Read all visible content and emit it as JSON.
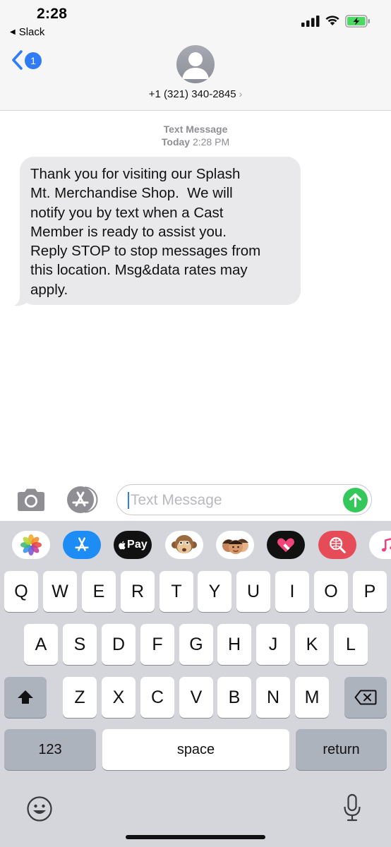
{
  "status_bar": {
    "time": "2:28",
    "back_app": "Slack",
    "icons": [
      "signal-icon",
      "wifi-icon",
      "battery-charging-icon"
    ],
    "battery_color": "#4cd964"
  },
  "header": {
    "back_badge": "1",
    "contact": "+1 (321) 340-2845",
    "chevron": "›",
    "accent_color": "#2f7cf6"
  },
  "thread": {
    "service_label": "Text Message",
    "date_day": "Today",
    "date_time": "2:28 PM",
    "messages": [
      {
        "direction": "incoming",
        "lines": [
          "Thank you for visiting our Splash",
          "Mt. Merchandise Shop.  We will",
          "notify you by text when a Cast",
          "Member is ready to assist you.",
          "Reply STOP to stop messages from",
          "this location. Msg&data rates may",
          "apply."
        ]
      }
    ]
  },
  "composer": {
    "placeholder": "Text Message",
    "send_color": "#34c759"
  },
  "app_drawer": {
    "apps": [
      {
        "name": "photos-app-icon"
      },
      {
        "name": "app-store-icon"
      },
      {
        "name": "apple-pay-icon",
        "label": "Pay"
      },
      {
        "name": "monkey-animoji-icon"
      },
      {
        "name": "memoji-icon"
      },
      {
        "name": "digital-touch-icon"
      },
      {
        "name": "images-search-icon"
      },
      {
        "name": "music-app-icon"
      }
    ]
  },
  "keyboard": {
    "row1": [
      "Q",
      "W",
      "E",
      "R",
      "T",
      "Y",
      "U",
      "I",
      "O",
      "P"
    ],
    "row2": [
      "A",
      "S",
      "D",
      "F",
      "G",
      "H",
      "J",
      "K",
      "L"
    ],
    "row3": [
      "Z",
      "X",
      "C",
      "V",
      "B",
      "N",
      "M"
    ],
    "numbers_key": "123",
    "space_key": "space",
    "return_key": "return"
  }
}
